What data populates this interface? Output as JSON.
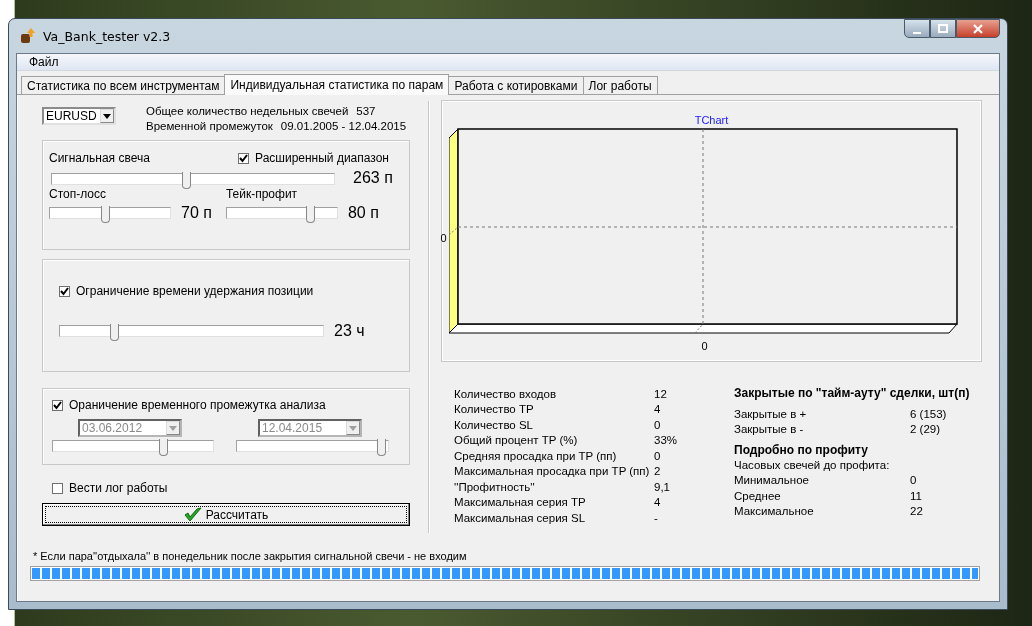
{
  "window": {
    "title": "Va_Bank_tester v2.3"
  },
  "menu": [
    "Файл"
  ],
  "tabs": [
    {
      "label": "Статистика по всем инструментам",
      "selected": false
    },
    {
      "label": "Индивидуальная статистика по парам",
      "selected": true
    },
    {
      "label": "Работа с котировками",
      "selected": false
    },
    {
      "label": "Лог работы",
      "selected": false
    }
  ],
  "pair": {
    "value": "EURUSD"
  },
  "info": [
    {
      "label": "Общее количество недельных свечей",
      "value": "537"
    },
    {
      "label": "Временной промежуток",
      "value": "09.01.2005 - 12.04.2015"
    }
  ],
  "signal": {
    "label": "Сигнальная свеча",
    "extended": {
      "label": "Расширенный диапазон",
      "checked": true
    },
    "level": 0.48,
    "reading": "263 п"
  },
  "stop_loss": {
    "label": "Стоп-лосс",
    "level": 0.47,
    "reading": "70 п"
  },
  "take_profit": {
    "label": "Тейк-профит",
    "level": 0.8,
    "reading": "80 п"
  },
  "hold_limit": {
    "label": "Ограничение времени удержания позиции",
    "checked": true,
    "level": 0.2,
    "reading": "23 ч"
  },
  "period_limit": {
    "label": "Ораничение временного промежутка анализа",
    "checked": true,
    "from": {
      "value": "03.06.2012",
      "disabled": true,
      "level": 0.71
    },
    "to": {
      "value": "12.04.2015",
      "disabled": true,
      "level": 1
    }
  },
  "log": {
    "label": "Вести лог работы",
    "checked": false
  },
  "calc_button": "Рассчитать",
  "note": "* Если пара''отдыхала'' в понедельник после закрытия сигнальной свечи - не входим",
  "progress": {
    "level": 1
  },
  "chart": {
    "title": "TChart",
    "y_tick": "0",
    "x_tick": "0"
  },
  "stats": [
    {
      "label": "Количество входов",
      "value": "12"
    },
    {
      "label": "Количество TP",
      "value": "4"
    },
    {
      "label": "Количество SL",
      "value": "0"
    },
    {
      "label": "Общий процент TP   (%)",
      "value": "33%"
    },
    {
      "label": "Средняя просадка при TP (пп)",
      "value": "0"
    },
    {
      "label": "Максимальная просадка при TP (пп)",
      "value": "2"
    },
    {
      "label": "''Профитность''",
      "value": "9,1"
    },
    {
      "label": "Максимальная серия TP",
      "value": "4"
    },
    {
      "label": "Максимальная серия SL",
      "value": "-"
    }
  ],
  "timeout": {
    "title": "Закрытые по \"тайм-ауту\" сделки, шт(п)",
    "rows": [
      {
        "label": "Закрытые в +",
        "value": "6 (153)"
      },
      {
        "label": "Закрытые в -",
        "value": "2 (29)"
      }
    ]
  },
  "profit": {
    "title": "Подробно по профиту",
    "subtitle": "Часовых свечей до профита:",
    "rows": [
      {
        "label": "Минимальное",
        "value": "0"
      },
      {
        "label": "Среднее",
        "value": "11"
      },
      {
        "label": "Максимальное",
        "value": "22"
      }
    ]
  }
}
